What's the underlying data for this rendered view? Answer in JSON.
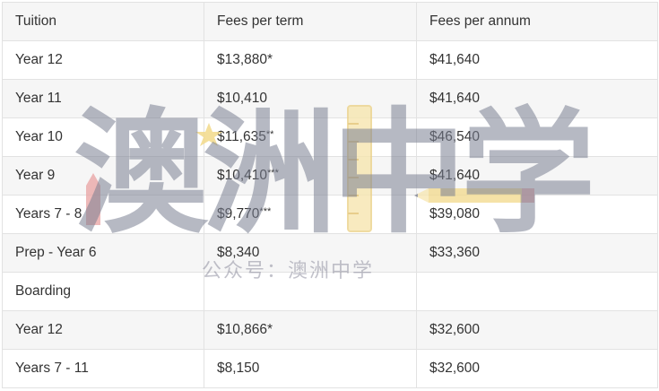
{
  "table": {
    "header": {
      "c1": "Tuition",
      "c2": "Fees per term",
      "c3": "Fees per annum"
    },
    "rows": [
      {
        "label": "Year 12",
        "term": "$13,880",
        "term_note": "*",
        "annum": "$41,640"
      },
      {
        "label": "Year 11",
        "term": "$10,410",
        "term_note": "",
        "annum": "$41,640"
      },
      {
        "label": "Year 10",
        "term": "$11,635",
        "term_note": "**",
        "annum": "$46,540"
      },
      {
        "label": "Year 9",
        "term": "$10,410",
        "term_note": "***",
        "annum": "$41,640"
      },
      {
        "label": "Years 7 - 8",
        "term": "$9,770",
        "term_note": "***",
        "annum": "$39,080"
      },
      {
        "label": "Prep - Year 6",
        "term": "$8,340",
        "term_note": "",
        "annum": "$33,360"
      }
    ],
    "boarding_heading": "Boarding",
    "boarding_rows": [
      {
        "label": "Year 12",
        "term": "$10,866",
        "term_note": "*",
        "annum": "$32,600"
      },
      {
        "label": "Years 7 - 11",
        "term": "$8,150",
        "term_note": "",
        "annum": "$32,600"
      }
    ]
  },
  "watermark": {
    "big_text": "澳洲中学",
    "sub_text": "公众号：澳洲中学",
    "colors": {
      "grey": "#7a7f92",
      "yellow": "#f2d98a",
      "pink": "#e9a2a2"
    }
  }
}
